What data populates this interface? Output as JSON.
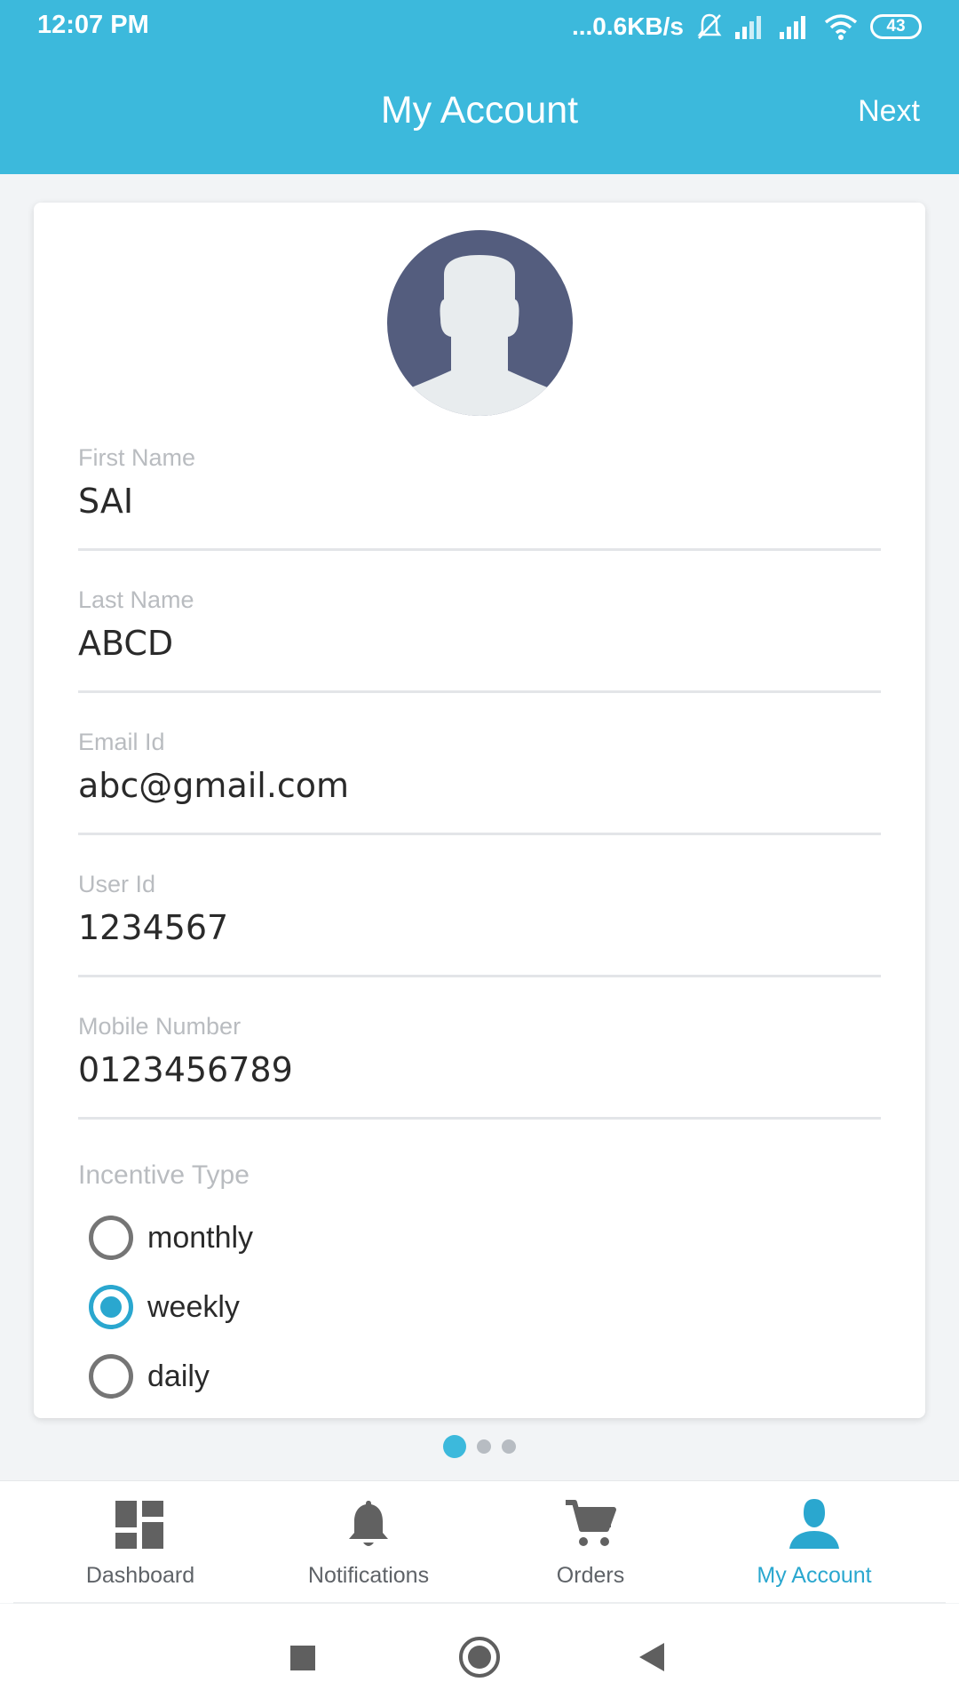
{
  "status_bar": {
    "time": "12:07 PM",
    "network_speed": "...0.6KB/s",
    "battery": "43",
    "icons": [
      "mute-icon",
      "signal-icon",
      "signal-icon",
      "wifi-icon",
      "battery-icon"
    ]
  },
  "app_bar": {
    "title": "My Account",
    "next_label": "Next"
  },
  "form": {
    "fields": [
      {
        "label": "First Name",
        "value": "SAI"
      },
      {
        "label": "Last Name",
        "value": "ABCD"
      },
      {
        "label": "Email Id",
        "value": "abc@gmail.com"
      },
      {
        "label": "User Id",
        "value": "1234567"
      },
      {
        "label": "Mobile Number",
        "value": "0123456789"
      }
    ],
    "incentive": {
      "label": "Incentive Type",
      "options": [
        "monthly",
        "weekly",
        "daily"
      ],
      "selected": "weekly"
    }
  },
  "pagination": {
    "total": 3,
    "current": 1
  },
  "bottom_nav": {
    "items": [
      {
        "label": "Dashboard",
        "icon": "dashboard-icon",
        "active": false
      },
      {
        "label": "Notifications",
        "icon": "bell-icon",
        "active": false
      },
      {
        "label": "Orders",
        "icon": "cart-icon",
        "active": false
      },
      {
        "label": "My Account",
        "icon": "person-icon",
        "active": true
      }
    ]
  },
  "colors": {
    "primary": "#3cb9dc",
    "accent": "#2aa7cf",
    "avatar_bg": "#545d7e",
    "label_gray": "#b9bcc0"
  },
  "system_nav": [
    "square-icon",
    "home-icon",
    "back-icon"
  ]
}
